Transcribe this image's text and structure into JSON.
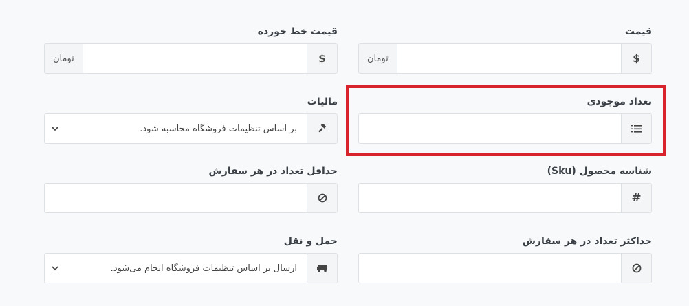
{
  "fields": {
    "price": {
      "label": "قیمت",
      "icon": "dollar-icon",
      "icon_char": "$",
      "value": "",
      "unit": "تومان"
    },
    "strikethrough_price": {
      "label": "قیمت خط خورده",
      "icon": "dollar-icon",
      "icon_char": "$",
      "value": "",
      "unit": "تومان"
    },
    "stock_count": {
      "label": "تعداد موجودی",
      "icon": "ordered-list-icon",
      "value": ""
    },
    "tax": {
      "label": "مالیات",
      "icon": "gavel-icon",
      "selected": "بر اساس تنظیمات فروشگاه محاسبه شود."
    },
    "sku": {
      "label": "شناسه محصول (Sku)",
      "icon": "hash-icon",
      "icon_char": "#",
      "value": ""
    },
    "min_order": {
      "label": "حداقل تعداد در هر سفارش",
      "icon": "ban-icon",
      "value": ""
    },
    "max_order": {
      "label": "حداکثر تعداد در هر سفارش",
      "icon": "ban-icon",
      "value": ""
    },
    "shipping": {
      "label": "حمل و نقل",
      "icon": "truck-icon",
      "selected": "ارسال بر اساس تنظیمات فروشگاه انجام می‌شود."
    }
  },
  "colors": {
    "highlight": "#d8222c",
    "addon_bg": "#f3f5f7",
    "border": "#dde1e5",
    "page_bg": "#f8f9fa"
  }
}
